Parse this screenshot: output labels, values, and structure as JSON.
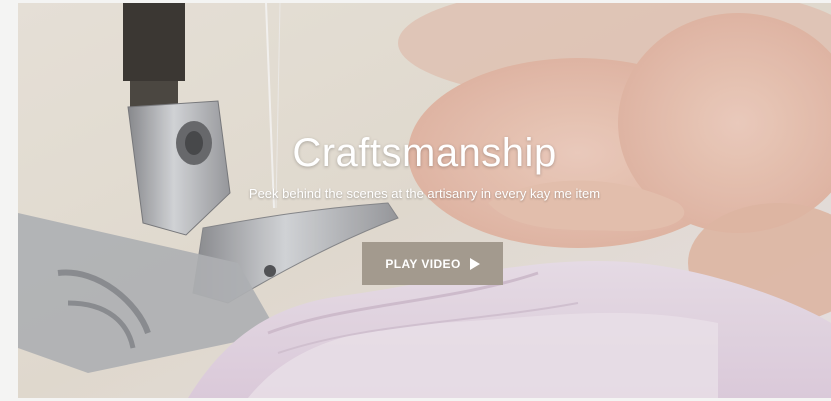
{
  "hero": {
    "title": "Craftsmanship",
    "subtitle": "Peek behind the scenes at the artisanry in every kay me item",
    "cta": {
      "label": "PLAY VIDEO",
      "icon": "play-icon"
    },
    "background_image": "sewing-machine-photo"
  },
  "colors": {
    "page_background": "#f4f4f3",
    "button_background": "#a39a8e",
    "text": "#ffffff"
  }
}
